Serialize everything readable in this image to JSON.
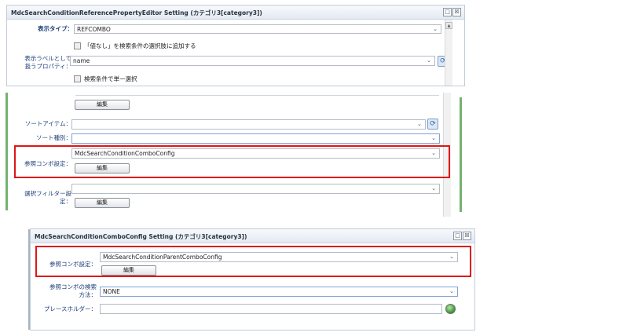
{
  "panel1": {
    "title": "MdcSearchConditionReferencePropertyEditor Setting (カテゴリ3[category3])",
    "display_type_label": "表示タイプ：",
    "display_type_value": "REFCOMBO",
    "add_no_value_label": "「値なし」を検索条件の選択肢に追加する",
    "display_label_prop_label_line1": "表示ラベルとして",
    "display_label_prop_label_line2": "扱うプロパティ：",
    "display_label_prop_value": "name",
    "single_select_label": "検索条件で単一選択",
    "restore_icon": "□",
    "close_icon": "☒"
  },
  "panel2": {
    "edit_button_top": "編集",
    "sort_item_label": "ソートアイテム：",
    "sort_item_value": "",
    "sort_rule_label": "ソート種別：",
    "sort_rule_value": "",
    "ref_combo_label": "参照コンボ設定：",
    "ref_combo_value": "MdcSearchConditionComboConfig",
    "ref_combo_edit": "編集",
    "filter_label_line1": "選択フィルター設",
    "filter_label_line2": "定：",
    "filter_value": "",
    "filter_edit": "編集"
  },
  "panel3": {
    "title": "MdcSearchConditionComboConfig Setting (カテゴリ3[category3])",
    "ref_combo_label": "参照コンボ設定：",
    "ref_combo_value": "MdcSearchConditionParentComboConfig",
    "ref_combo_edit": "編集",
    "search_method_label_line1": "参照コンボの検索",
    "search_method_label_line2": "方法：",
    "search_method_value": "NONE",
    "placeholder_label": "プレースホルダー：",
    "placeholder_value": "",
    "restore_icon": "□",
    "close_icon": "☒"
  },
  "icons": {
    "dropdown_arrow": "⌄",
    "refresh": "⟳",
    "scroll_up": "▲"
  },
  "colors": {
    "highlight": "#e01616",
    "label_text": "#1f3f7a",
    "frame_green": "#74b26f"
  }
}
